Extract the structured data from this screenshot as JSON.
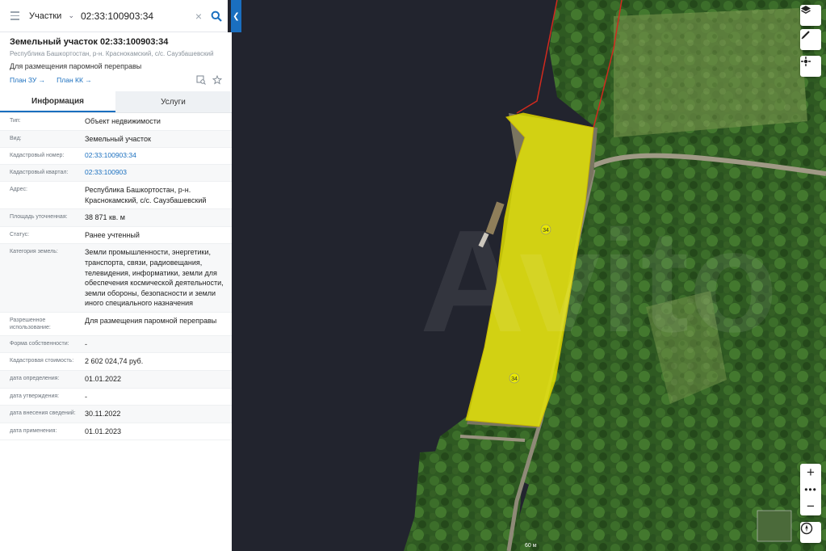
{
  "search": {
    "type_label": "Участки",
    "query": "02:33:100903:34"
  },
  "object": {
    "title": "Земельный участок 02:33:100903:34",
    "address_short": "Республика Башкортостан, р-н. Краснокамский, с/с. Саузбашевский",
    "purpose": "Для размещения паромной переправы",
    "link_plan_zu": "План ЗУ →",
    "link_plan_kk": "План КК →"
  },
  "tabs": [
    {
      "label": "Информация",
      "active": true
    },
    {
      "label": "Услуги",
      "active": false
    }
  ],
  "fields": [
    {
      "key": "Тип:",
      "value": "Объект недвижимости"
    },
    {
      "key": "Вид:",
      "value": "Земельный участок"
    },
    {
      "key": "Кадастровый номер:",
      "value": "02:33:100903:34",
      "link": true
    },
    {
      "key": "Кадастровый квартал:",
      "value": "02:33:100903",
      "link": true
    },
    {
      "key": "Адрес:",
      "value": "Республика Башкортостан, р-н. Краснокамский, с/с. Саузбашевский"
    },
    {
      "key": "Площадь уточненная:",
      "value": "38 871 кв. м"
    },
    {
      "key": "Статус:",
      "value": "Ранее учтенный"
    },
    {
      "key": "Категория земель:",
      "value": "Земли промышленности, энергетики, транспорта, связи, радиовещания, телевидения, информатики, земли для обеспечения космической деятельности, земли обороны, безопасности и земли иного специального назначения"
    },
    {
      "key": "Разрешенное использование:",
      "value": "Для размещения паромной переправы"
    },
    {
      "key": "Форма собственности:",
      "value": "-"
    },
    {
      "key": "Кадастровая стоимость:",
      "value": "2 602 024,74 руб."
    },
    {
      "key": "дата определения:",
      "value": "01.01.2022"
    },
    {
      "key": "дата утверждения:",
      "value": "-"
    },
    {
      "key": "дата внесения сведений:",
      "value": "30.11.2022"
    },
    {
      "key": "дата применения:",
      "value": "01.01.2023"
    }
  ],
  "map": {
    "parcel_label_1": "34",
    "parcel_label_2": "34",
    "scale_label": "60 м",
    "watermark": "Avito",
    "parcel_color": "#e8e800",
    "water_color": "#23252f",
    "boundary_color": "#d22a1e"
  },
  "controls": {
    "zoom_in": "+",
    "more": "•••",
    "zoom_out": "−"
  }
}
